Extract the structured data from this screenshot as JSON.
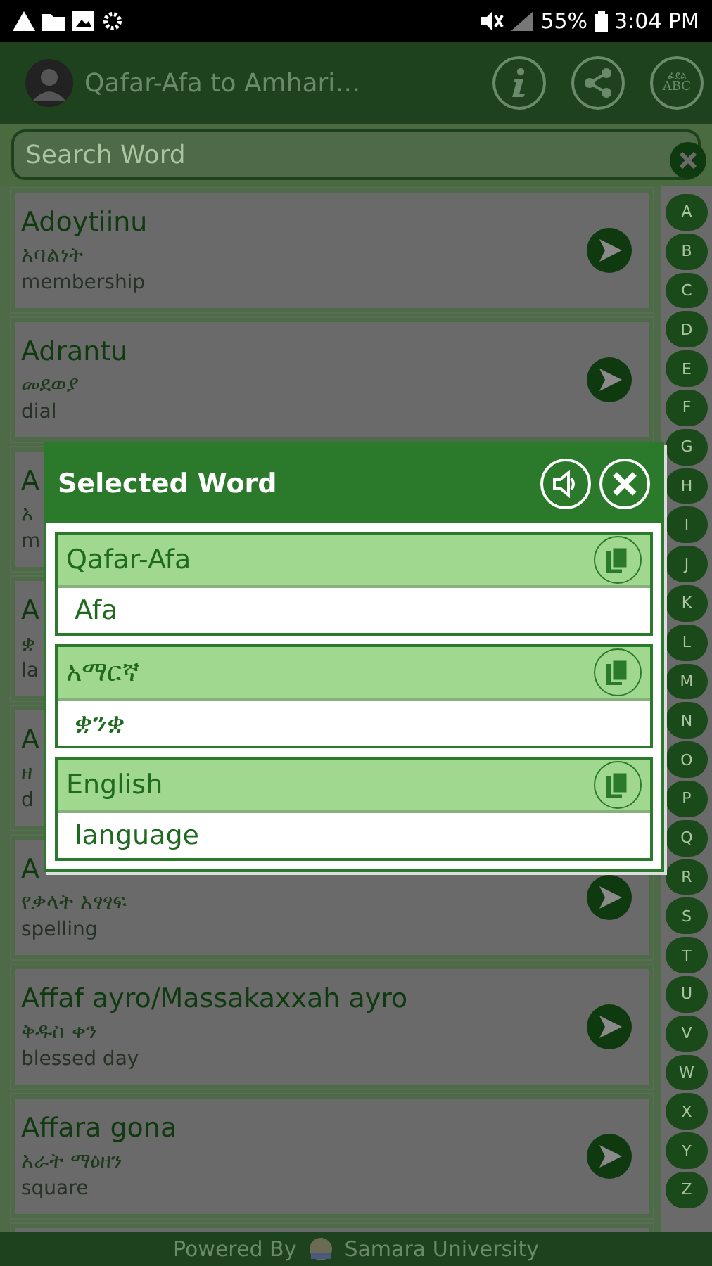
{
  "status_bar": {
    "battery": "55%",
    "time": "3:04 PM"
  },
  "header": {
    "title": "Qafar-Afa to Amhari…",
    "abc_icon_script": "ፊደል",
    "abc_icon_text": "ABC"
  },
  "search": {
    "placeholder": "Search Word"
  },
  "words_above_dialog": [
    {
      "term": "Adoytiinu",
      "amharic": "አባልነት",
      "english": "membership"
    },
    {
      "term": "Adrantu",
      "amharic": "መደወያ",
      "english": "dial"
    }
  ],
  "words_under_dialog": [
    {
      "term": "A",
      "amharic": "አ",
      "english": "m"
    },
    {
      "term": "A",
      "amharic": "ቋ",
      "english": "la"
    },
    {
      "term": "A",
      "amharic": "ዘ",
      "english": "d"
    }
  ],
  "words_below_dialog": [
    {
      "term": "A",
      "amharic": "የቃላት አፃፃፍ",
      "english": "spelling"
    },
    {
      "term": "Affaf ayro/Massakaxxah ayro",
      "amharic": "ቅዱስ ቀን",
      "english": "blessed day"
    },
    {
      "term": "Affara gona",
      "amharic": "አራት ማዕዘን",
      "english": "square"
    }
  ],
  "alphabet": [
    "A",
    "B",
    "C",
    "D",
    "E",
    "F",
    "G",
    "H",
    "I",
    "J",
    "K",
    "L",
    "M",
    "N",
    "O",
    "P",
    "Q",
    "R",
    "S",
    "T",
    "U",
    "V",
    "W",
    "X",
    "Y",
    "Z"
  ],
  "dialog": {
    "title": "Selected Word",
    "sections": [
      {
        "language": "Qafar-Afa",
        "word": "Afa"
      },
      {
        "language": "አማርኛ",
        "word": "ቋንቋ"
      },
      {
        "language": "English",
        "word": "language"
      }
    ]
  },
  "footer": {
    "powered": "Powered By",
    "org": "Samara University"
  }
}
